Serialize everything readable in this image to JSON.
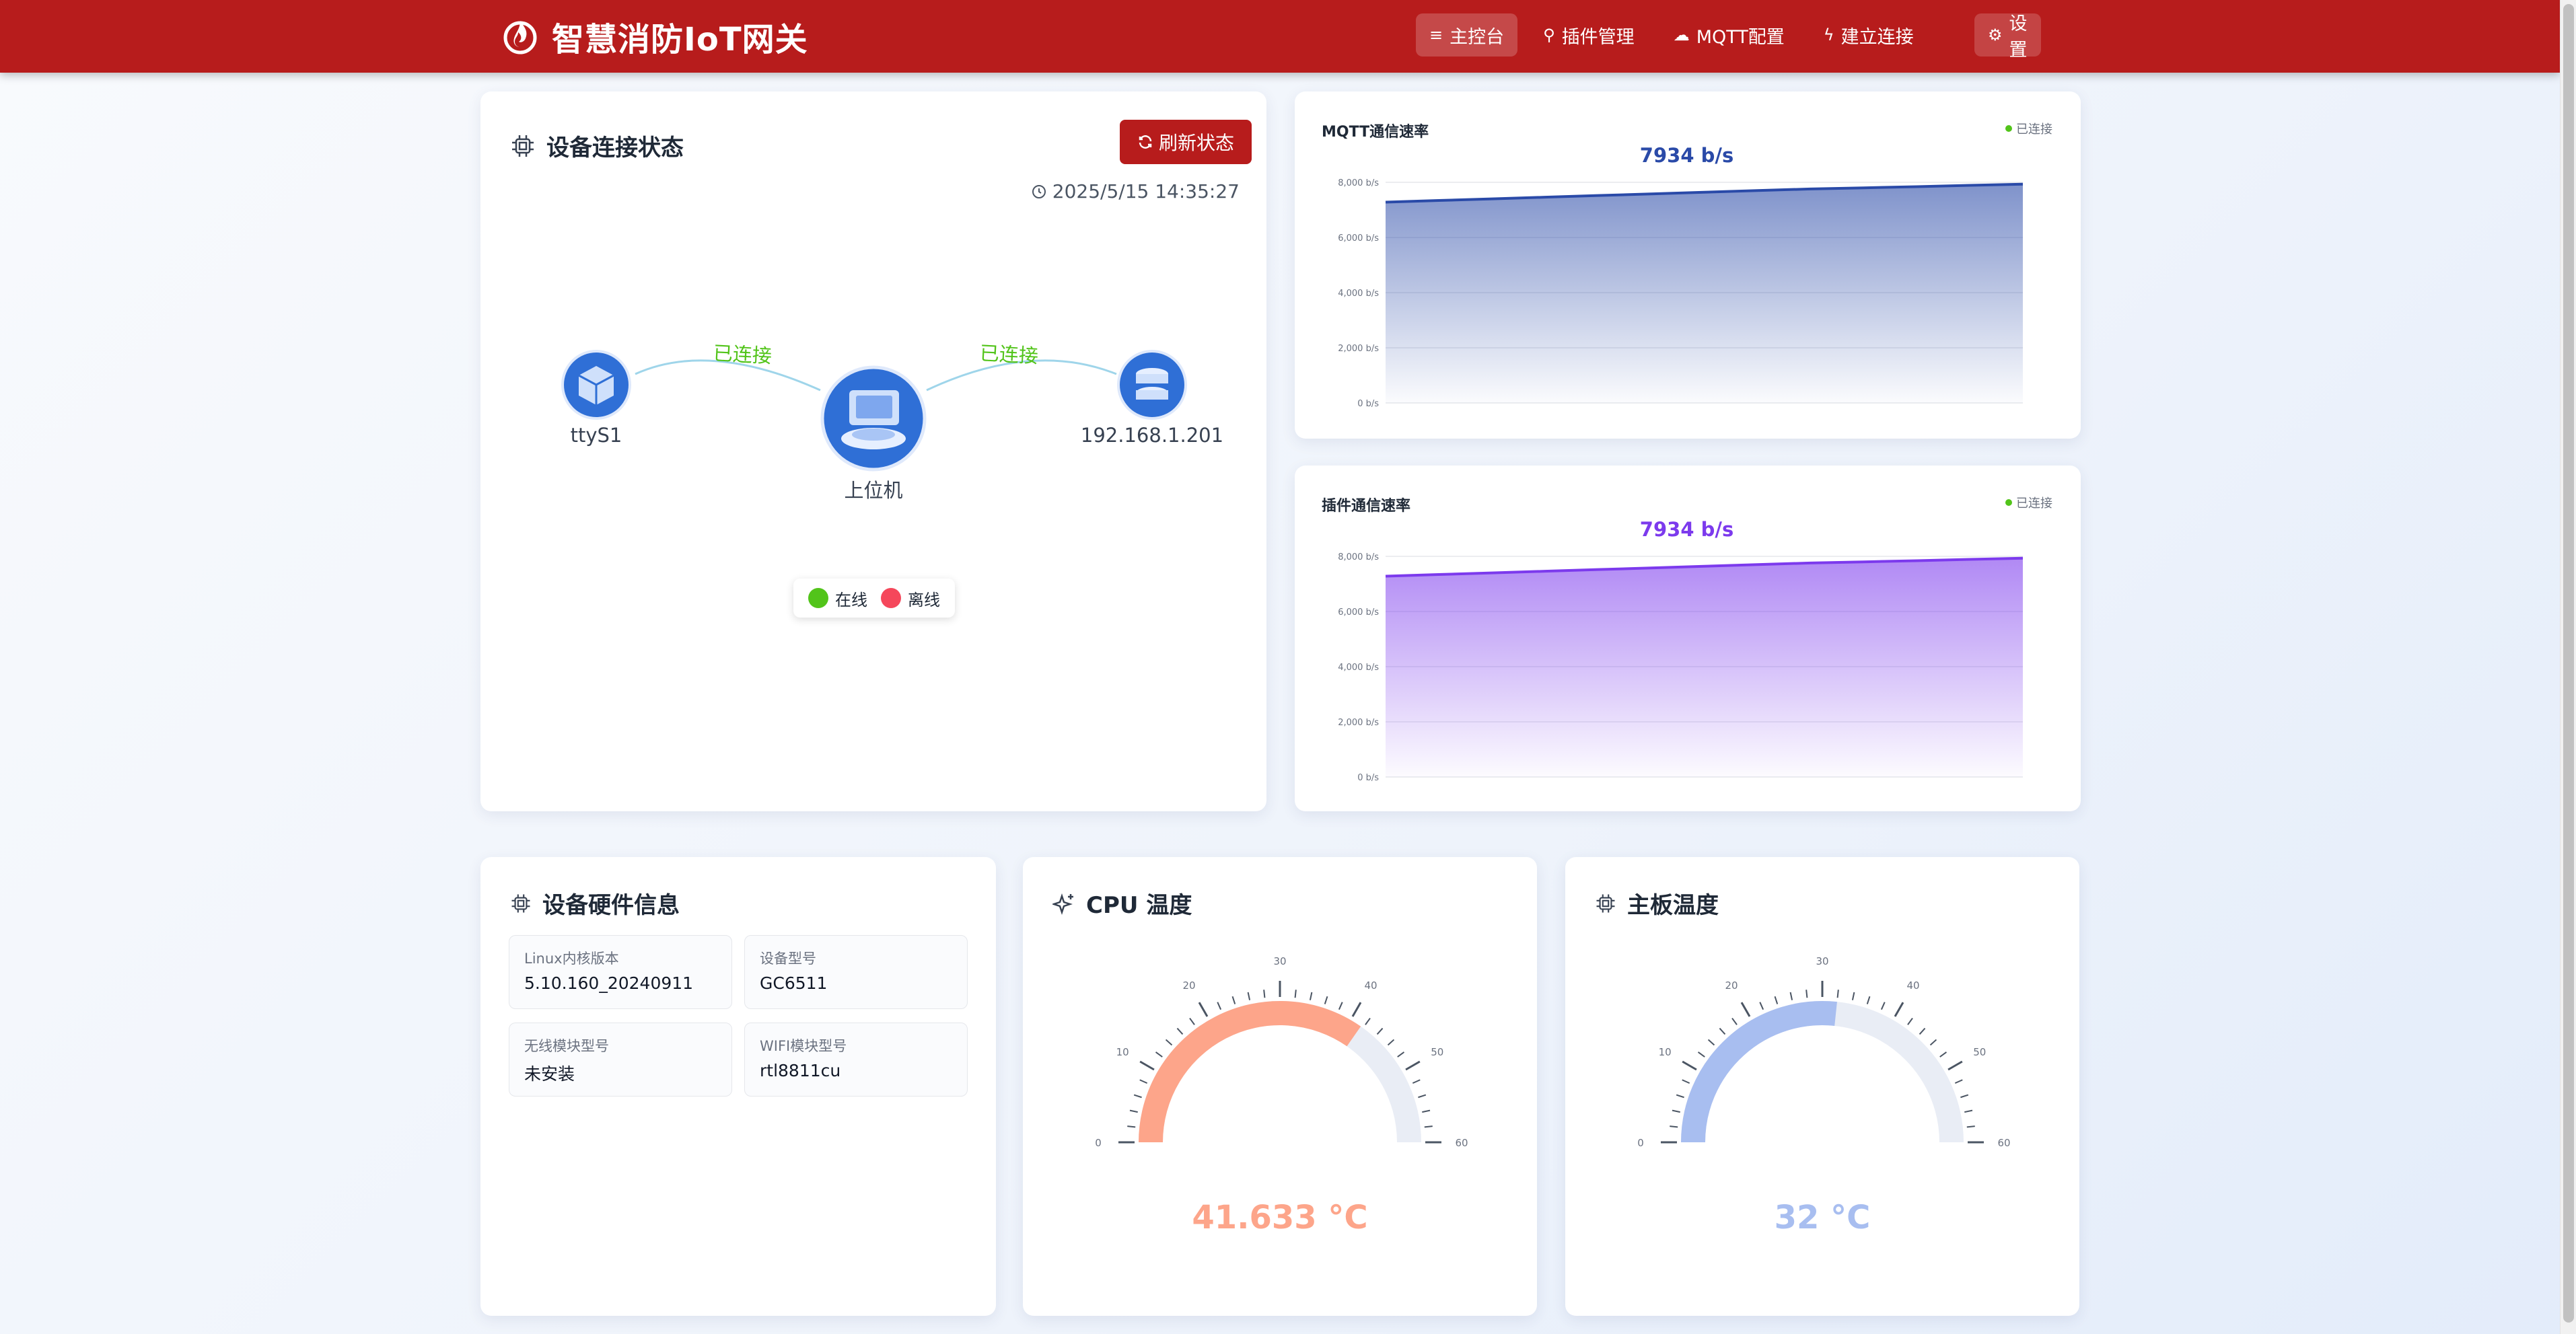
{
  "app": {
    "title": "智慧消防IoT网关"
  },
  "nav": {
    "items": [
      {
        "label": "主控台",
        "icon": "menu-icon",
        "active": true
      },
      {
        "label": "插件管理",
        "icon": "plugin-icon",
        "active": false
      },
      {
        "label": "MQTT配置",
        "icon": "cloud-upload-icon",
        "active": false
      },
      {
        "label": "建立连接",
        "icon": "lightning-icon",
        "active": false
      },
      {
        "label": "设置",
        "icon": "gear-icon",
        "active": false
      }
    ]
  },
  "connection": {
    "title": "设备连接状态",
    "refresh_label": "刷新状态",
    "timestamp": "2025/5/15 14:35:27",
    "nodes": {
      "left": "ttyS1",
      "center": "上位机",
      "right": "192.168.1.201"
    },
    "links": {
      "left": "已连接",
      "right": "已连接"
    },
    "legend": {
      "online": "在线",
      "offline": "离线"
    },
    "colors": {
      "online": "#52c41a",
      "offline": "#f5475b",
      "node": "#2f6fd6"
    }
  },
  "chart_data": [
    {
      "type": "area",
      "title": "MQTT通信速率",
      "status": "已连接",
      "current_value": "7934 b/s",
      "x": [
        0,
        1,
        2,
        3,
        4,
        5,
        6,
        7,
        8,
        9,
        10,
        11,
        12
      ],
      "values": [
        7280,
        7340,
        7400,
        7460,
        7520,
        7580,
        7640,
        7700,
        7760,
        7800,
        7840,
        7890,
        7934
      ],
      "ylim": [
        0,
        8000
      ],
      "yticks": [
        "0 b/s",
        "2,000 b/s",
        "4,000 b/s",
        "6,000 b/s",
        "8,000 b/s"
      ],
      "color": "#2a4aa8",
      "grid": true
    },
    {
      "type": "area",
      "title": "插件通信速率",
      "status": "已连接",
      "current_value": "7934 b/s",
      "x": [
        0,
        1,
        2,
        3,
        4,
        5,
        6,
        7,
        8,
        9,
        10,
        11,
        12
      ],
      "values": [
        7280,
        7340,
        7400,
        7460,
        7520,
        7580,
        7640,
        7700,
        7760,
        7800,
        7840,
        7890,
        7934
      ],
      "ylim": [
        0,
        8000
      ],
      "yticks": [
        "0 b/s",
        "2,000 b/s",
        "4,000 b/s",
        "6,000 b/s",
        "8,000 b/s"
      ],
      "color": "#7c3aed",
      "grid": true
    }
  ],
  "hardware": {
    "title": "设备硬件信息",
    "items": [
      {
        "label": "Linux内核版本",
        "value": "5.10.160_20240911"
      },
      {
        "label": "设备型号",
        "value": "GC6511"
      },
      {
        "label": "无线模块型号",
        "value": "未安装"
      },
      {
        "label": "WIFI模块型号",
        "value": "rtl8811cu"
      }
    ]
  },
  "gauges": [
    {
      "title": "CPU 温度",
      "icon": "sparkle-icon",
      "value": 41.633,
      "display": "41.633 °C",
      "min": 0,
      "max": 60,
      "ticks": [
        "0",
        "10",
        "20",
        "30",
        "40",
        "50",
        "60"
      ],
      "color": "#fda58a"
    },
    {
      "title": "主板温度",
      "icon": "chip-icon",
      "value": 32,
      "display": "32 °C",
      "min": 0,
      "max": 60,
      "ticks": [
        "0",
        "10",
        "20",
        "30",
        "40",
        "50",
        "60"
      ],
      "color": "#a8bef0"
    }
  ]
}
